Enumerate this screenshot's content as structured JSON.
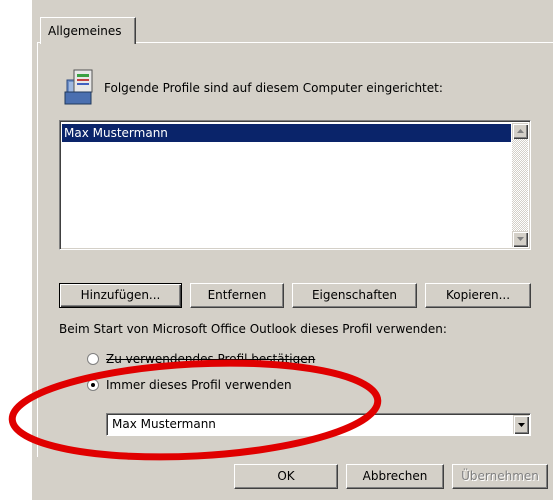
{
  "tabs": [
    {
      "label": "Allgemeines"
    }
  ],
  "header": {
    "text": "Folgende Profile sind auf diesem Computer eingerichtet:",
    "icon": "profile-mail-icon"
  },
  "profiles": [
    "Max Mustermann"
  ],
  "buttons": {
    "add": "Hinzufügen...",
    "remove": "Entfernen",
    "properties": "Eigenschaften",
    "copy": "Kopieren..."
  },
  "startup": {
    "label": "Beim Start von Microsoft Office Outlook dieses Profil verwenden:",
    "option_confirm": "Zu verwendendes Profil bestätigen",
    "option_always": "Immer dieses Profil verwenden",
    "selected_option": "always",
    "selected_profile": "Max Mustermann"
  },
  "footer": {
    "ok": "OK",
    "cancel": "Abbrechen",
    "apply": "Übernehmen"
  },
  "colors": {
    "dialog_bg": "#d4d0c8",
    "selection_bg": "#0a246a",
    "annotation": "#e00000"
  }
}
